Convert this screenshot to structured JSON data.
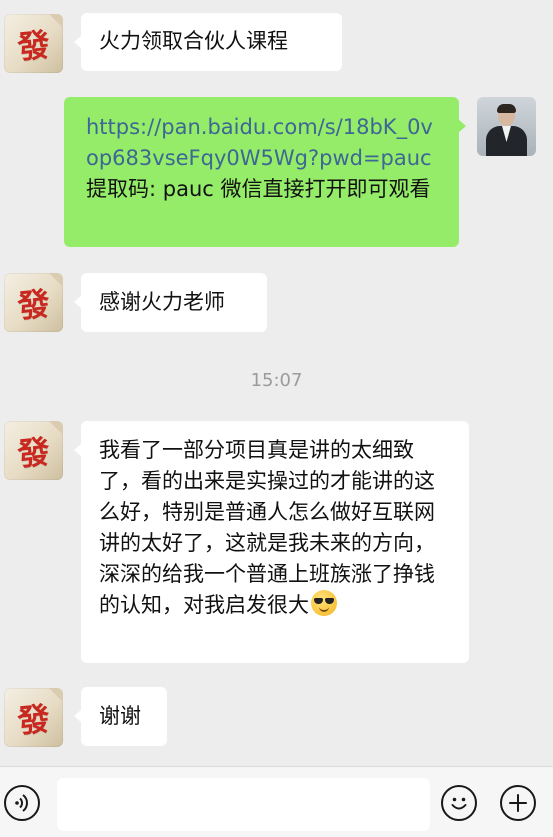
{
  "messages": [
    {
      "side": "left",
      "text": "火力领取合伙人课程"
    },
    {
      "side": "right",
      "link_text": "https://pan.baidu.com/s/18bK_0vop683vseFqy0W5Wg?pwd=pauc",
      "text": " 提取码: pauc 微信直接打开即可观看"
    },
    {
      "side": "left",
      "text": "感谢火力老师"
    },
    {
      "side": "left",
      "text": "我看了一部分项目真是讲的太细致了，看的出来是实操过的才能讲的这么好，特别是普通人怎么做好互联网讲的太好了，这就是我未来的方向，深深的给我一个普通上班族涨了挣钱的认知，对我启发很大",
      "emoji": "sunglasses-emoji"
    },
    {
      "side": "left",
      "text": "谢谢"
    }
  ],
  "timestamp": "15:07",
  "avatars": {
    "left_glyph": "發"
  },
  "input": {
    "value": "",
    "placeholder": ""
  },
  "colors": {
    "background": "#ededed",
    "sent_bubble": "#95ec69",
    "received_bubble": "#ffffff",
    "link": "#3d6794",
    "timestamp": "#9b9b9b"
  },
  "icons": {
    "voice": "voice-icon",
    "emoji": "emoji-face-icon",
    "plus": "plus-icon"
  }
}
